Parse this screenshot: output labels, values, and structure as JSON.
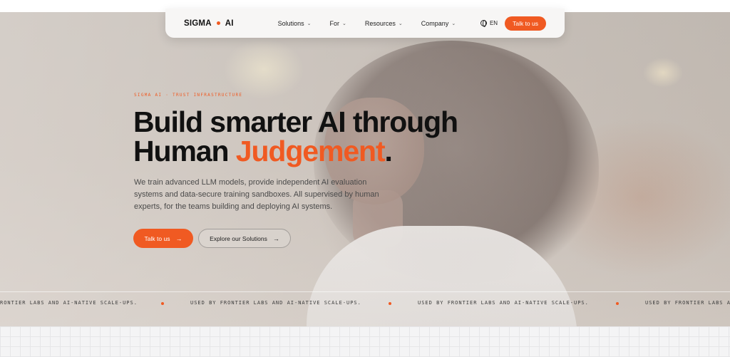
{
  "nav": {
    "logo_left": "SIGMA",
    "logo_right": "AI",
    "links": [
      {
        "label": "Solutions"
      },
      {
        "label": "For"
      },
      {
        "label": "Resources"
      },
      {
        "label": "Company"
      }
    ],
    "language": "EN",
    "cta": "Talk to us"
  },
  "hero": {
    "eyebrow": "SIGMA AI · TRUST INFRASTRUCTURE",
    "headline_line1": "Build smarter AI through",
    "headline_line2_start": "Human ",
    "headline_accent": "Judgement",
    "headline_end": ".",
    "subtext": "We train advanced LLM models, provide independent AI evaluation systems and data-secure training sandboxes. All supervised by human experts, for the teams building and deploying AI systems.",
    "primary_cta": "Talk to us",
    "secondary_cta": "Explore our Solutions"
  },
  "ticker": {
    "items": [
      "RONTIER LABS AND AI-NATIVE SCALE-UPS.",
      "USED BY FRONTIER LABS AND AI-NATIVE SCALE-UPS.",
      "USED BY FRONTIER LABS AND AI-NATIVE SCALE-UPS.",
      "USED BY FRONTIER LABS AND AI-"
    ]
  },
  "colors": {
    "accent": "#f05a22",
    "text": "#111111"
  },
  "icons": {
    "chevron": "chevron-down-icon",
    "globe": "globe-icon",
    "arrow": "arrow-right-icon"
  }
}
